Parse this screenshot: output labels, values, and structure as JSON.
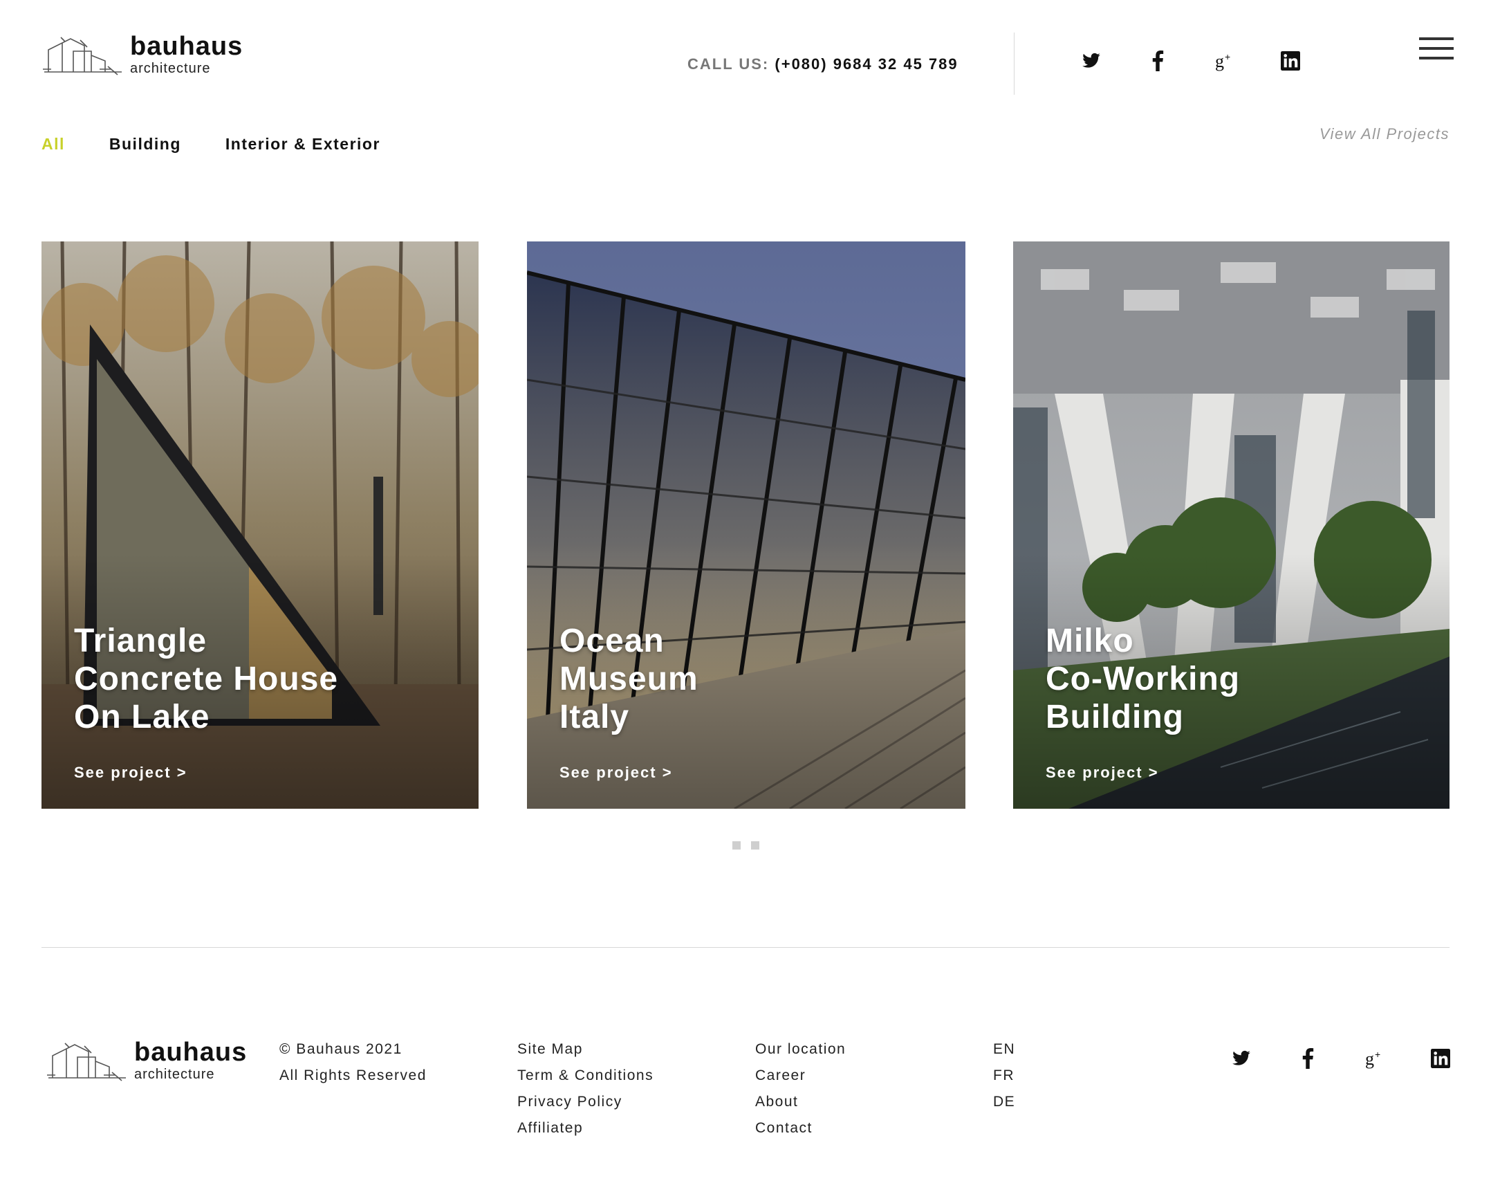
{
  "brand": {
    "name": "bauhaus",
    "tagline": "architecture"
  },
  "header": {
    "call_label": "CALL US:",
    "call_number": "(+080) 9684 32 45 789",
    "social": [
      "twitter-icon",
      "facebook-icon",
      "google-plus-icon",
      "linkedin-icon"
    ],
    "menu_icon": "hamburger-icon"
  },
  "filters": {
    "items": [
      "All",
      "Building",
      "Interior & Exterior"
    ],
    "active": "All",
    "active_color": "#c8d12b",
    "view_all": "View All Projects"
  },
  "projects": [
    {
      "title_lines": [
        "Triangle",
        "Concrete House",
        "On Lake"
      ],
      "link": "See project >"
    },
    {
      "title_lines": [
        "Ocean",
        "Museum",
        "Italy"
      ],
      "link": "See project >"
    },
    {
      "title_lines": [
        "Milko",
        "Co-Working",
        "Building"
      ],
      "link": "See project >"
    }
  ],
  "pagination": {
    "dots": 2
  },
  "footer": {
    "copyright": "© Bauhaus 2021",
    "rights": "All Rights Reserved",
    "links_1": [
      "Site Map",
      "Term & Conditions",
      "Privacy Policy",
      "Affiliatep"
    ],
    "links_2": [
      "Our location",
      "Career",
      "About",
      "Contact"
    ],
    "languages": [
      "EN",
      "FR",
      "DE"
    ],
    "social": [
      "twitter-icon",
      "facebook-icon",
      "google-plus-icon",
      "linkedin-icon"
    ]
  }
}
